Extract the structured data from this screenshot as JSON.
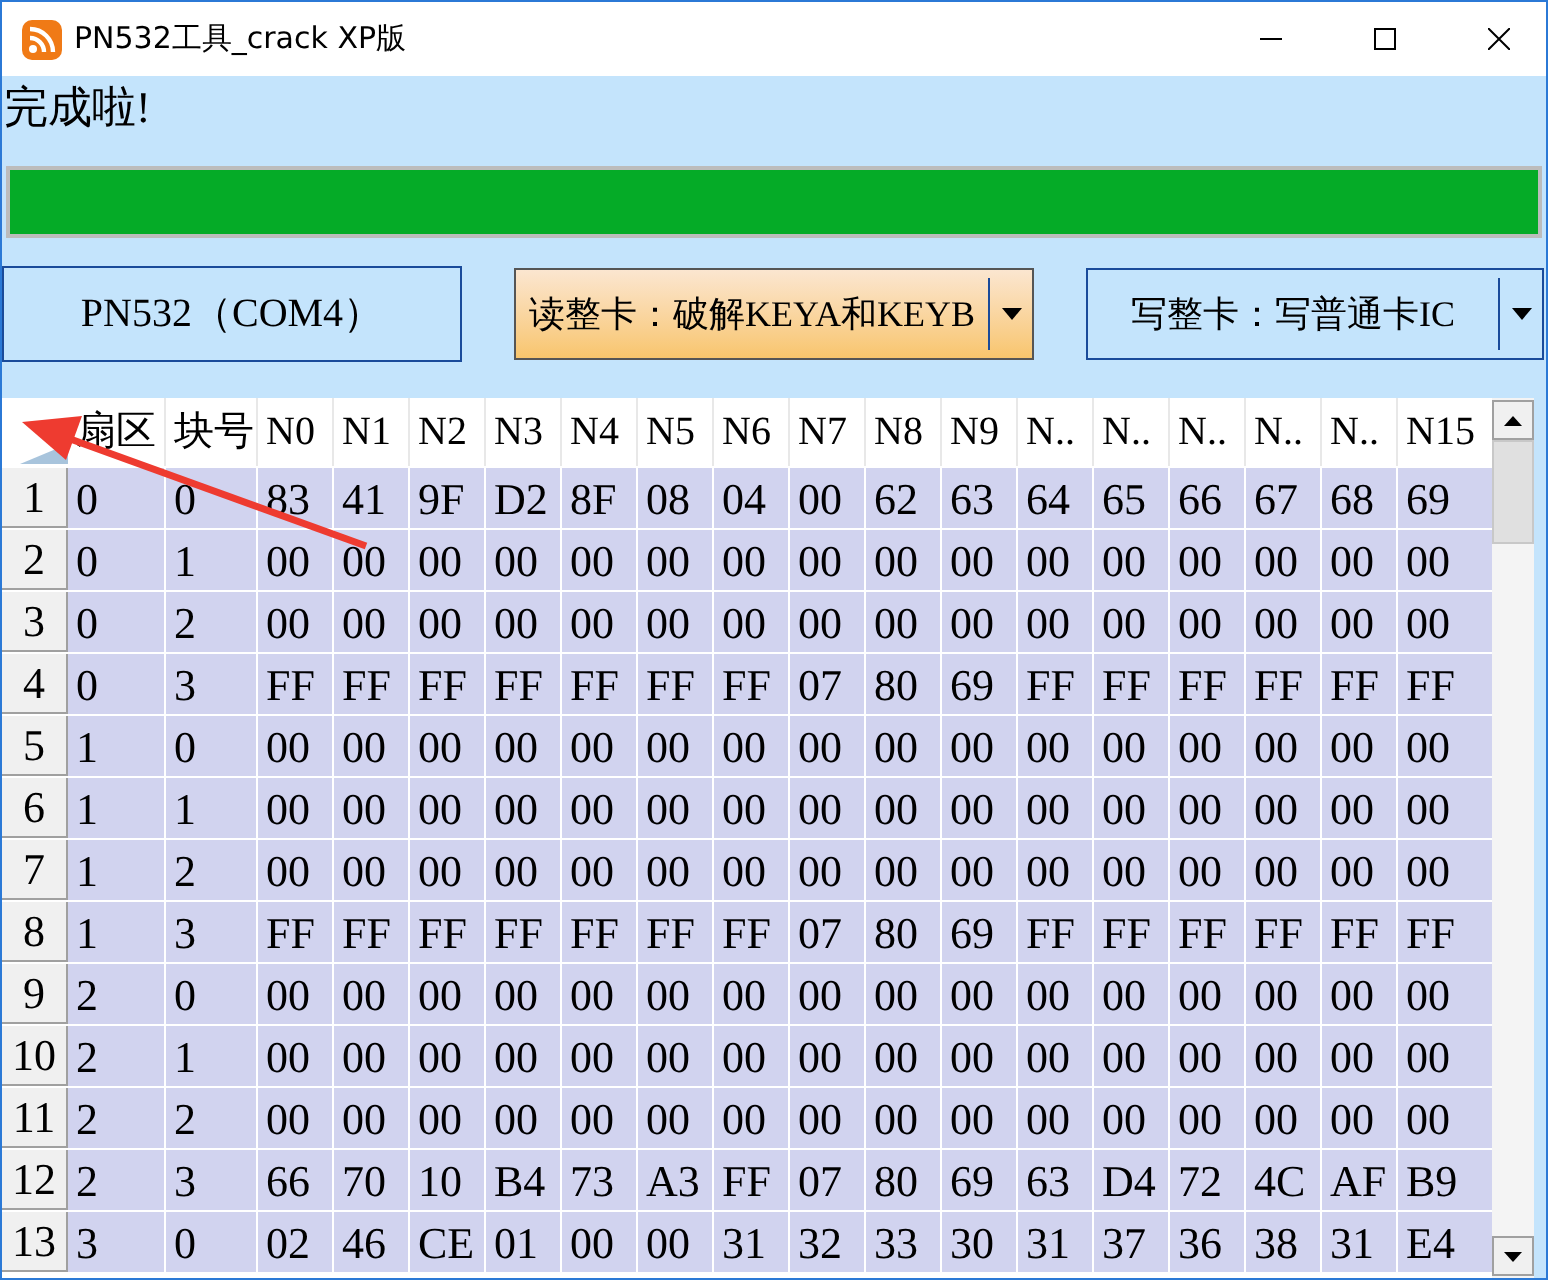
{
  "window": {
    "title": "PN532工具_crack XP版"
  },
  "status": "完成啦!",
  "progress": {
    "level": 1
  },
  "buttons": [
    {
      "label": "PN532（COM4）",
      "kind": "plain",
      "highlighted": false
    },
    {
      "label": "读整卡：破解KEYA和KEYB",
      "kind": "dropdown",
      "highlighted": true
    },
    {
      "label": "写整卡：写普通卡IC",
      "kind": "dropdown",
      "highlighted": false
    }
  ],
  "table": {
    "columns": [
      "扇区",
      "块号",
      "N0",
      "N1",
      "N2",
      "N3",
      "N4",
      "N5",
      "N6",
      "N7",
      "N8",
      "N9",
      "N..",
      "N..",
      "N..",
      "N..",
      "N..",
      "N15"
    ],
    "rows": [
      {
        "number": "1",
        "cells": [
          "0",
          "0",
          "83",
          "41",
          "9F",
          "D2",
          "8F",
          "08",
          "04",
          "00",
          "62",
          "63",
          "64",
          "65",
          "66",
          "67",
          "68",
          "69"
        ]
      },
      {
        "number": "2",
        "cells": [
          "0",
          "1",
          "00",
          "00",
          "00",
          "00",
          "00",
          "00",
          "00",
          "00",
          "00",
          "00",
          "00",
          "00",
          "00",
          "00",
          "00",
          "00"
        ]
      },
      {
        "number": "3",
        "cells": [
          "0",
          "2",
          "00",
          "00",
          "00",
          "00",
          "00",
          "00",
          "00",
          "00",
          "00",
          "00",
          "00",
          "00",
          "00",
          "00",
          "00",
          "00"
        ]
      },
      {
        "number": "4",
        "cells": [
          "0",
          "3",
          "FF",
          "FF",
          "FF",
          "FF",
          "FF",
          "FF",
          "FF",
          "07",
          "80",
          "69",
          "FF",
          "FF",
          "FF",
          "FF",
          "FF",
          "FF"
        ]
      },
      {
        "number": "5",
        "cells": [
          "1",
          "0",
          "00",
          "00",
          "00",
          "00",
          "00",
          "00",
          "00",
          "00",
          "00",
          "00",
          "00",
          "00",
          "00",
          "00",
          "00",
          "00"
        ]
      },
      {
        "number": "6",
        "cells": [
          "1",
          "1",
          "00",
          "00",
          "00",
          "00",
          "00",
          "00",
          "00",
          "00",
          "00",
          "00",
          "00",
          "00",
          "00",
          "00",
          "00",
          "00"
        ]
      },
      {
        "number": "7",
        "cells": [
          "1",
          "2",
          "00",
          "00",
          "00",
          "00",
          "00",
          "00",
          "00",
          "00",
          "00",
          "00",
          "00",
          "00",
          "00",
          "00",
          "00",
          "00"
        ]
      },
      {
        "number": "8",
        "cells": [
          "1",
          "3",
          "FF",
          "FF",
          "FF",
          "FF",
          "FF",
          "FF",
          "FF",
          "07",
          "80",
          "69",
          "FF",
          "FF",
          "FF",
          "FF",
          "FF",
          "FF"
        ]
      },
      {
        "number": "9",
        "cells": [
          "2",
          "0",
          "00",
          "00",
          "00",
          "00",
          "00",
          "00",
          "00",
          "00",
          "00",
          "00",
          "00",
          "00",
          "00",
          "00",
          "00",
          "00"
        ]
      },
      {
        "number": "10",
        "cells": [
          "2",
          "1",
          "00",
          "00",
          "00",
          "00",
          "00",
          "00",
          "00",
          "00",
          "00",
          "00",
          "00",
          "00",
          "00",
          "00",
          "00",
          "00"
        ]
      },
      {
        "number": "11",
        "cells": [
          "2",
          "2",
          "00",
          "00",
          "00",
          "00",
          "00",
          "00",
          "00",
          "00",
          "00",
          "00",
          "00",
          "00",
          "00",
          "00",
          "00",
          "00"
        ]
      },
      {
        "number": "12",
        "cells": [
          "2",
          "3",
          "66",
          "70",
          "10",
          "B4",
          "73",
          "A3",
          "FF",
          "07",
          "80",
          "69",
          "63",
          "D4",
          "72",
          "4C",
          "AF",
          "B9"
        ]
      },
      {
        "number": "13",
        "cells": [
          "3",
          "0",
          "02",
          "46",
          "CE",
          "01",
          "00",
          "00",
          "31",
          "32",
          "33",
          "30",
          "31",
          "37",
          "36",
          "38",
          "31",
          "E4"
        ]
      }
    ]
  }
}
